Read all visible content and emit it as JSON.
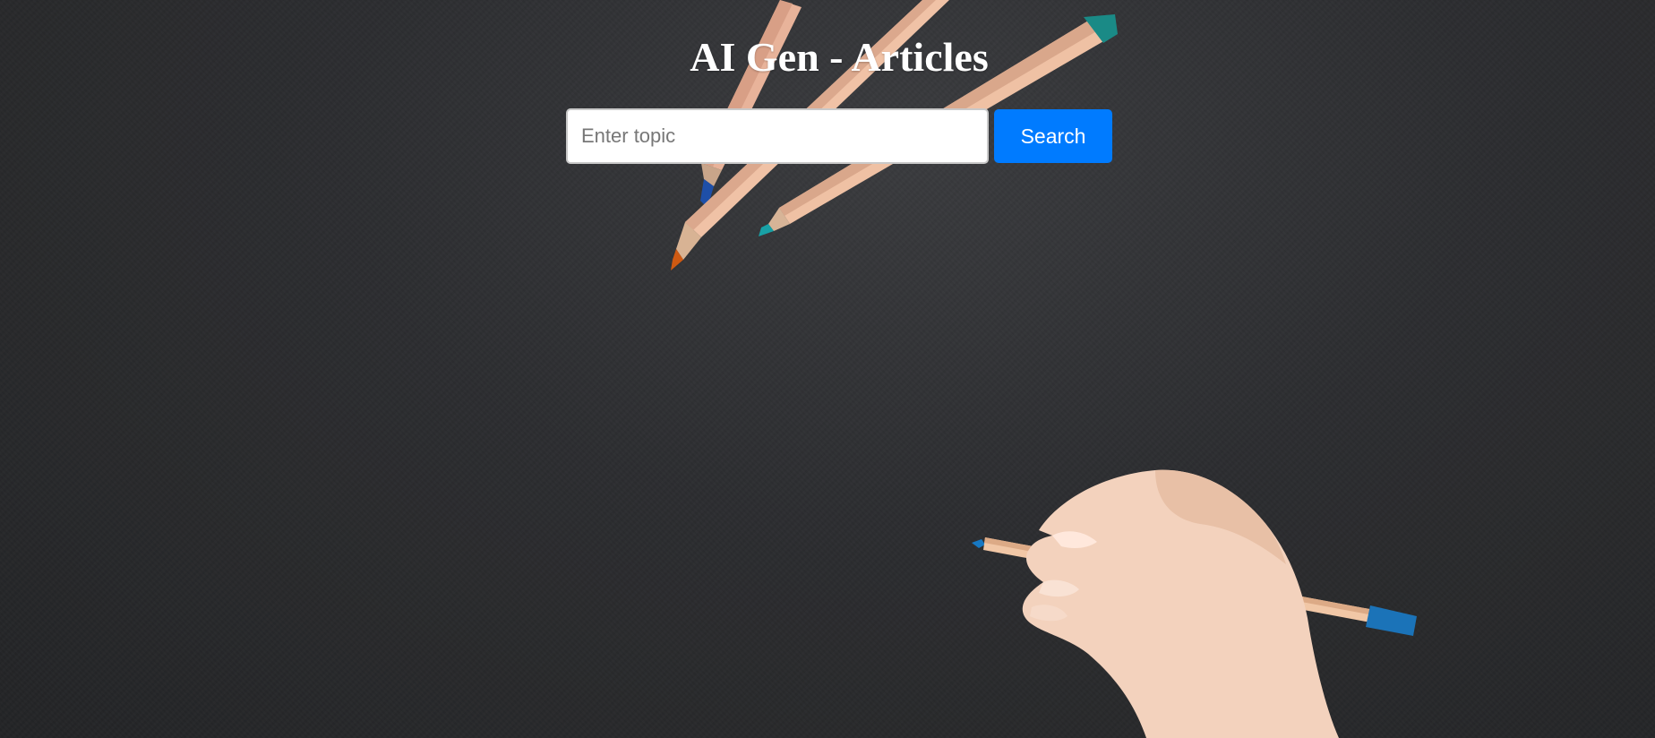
{
  "page": {
    "title": "AI Gen - Articles"
  },
  "search": {
    "placeholder": "Enter topic",
    "value": "",
    "button_label": "Search"
  },
  "colors": {
    "background": "#2c2d30",
    "title_text": "#ffffff",
    "button_bg": "#007bff",
    "button_text": "#ffffff"
  }
}
